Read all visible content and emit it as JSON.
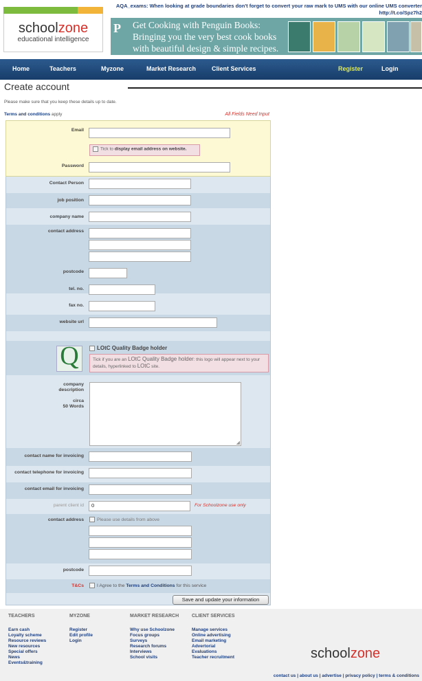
{
  "ticker": "AQA_exams: When looking at grade boundaries don't forget to convert your raw mark to UMS with our online UMS converter http://t.co/Spz7h2",
  "logo": {
    "name": "school",
    "name_accent": "zone",
    "tagline": "educational intelligence"
  },
  "banner": {
    "line1": "Get Cooking with Penguin Books:",
    "line2": "Bringing you the very best cook books",
    "line3": "with beautiful design & simple recipes."
  },
  "nav": {
    "home": "Home",
    "teachers": "Teachers",
    "myzone": "Myzone",
    "market": "Market Research",
    "client": "Client Services",
    "register": "Register",
    "login": "Login"
  },
  "page": {
    "title": "Create account",
    "intro": "Please make sure that you keep these details up to date.",
    "terms_link": "Terms and conditions",
    "terms_suffix": "apply",
    "required_note": "All Fields Need Input"
  },
  "form": {
    "email_label": "Email",
    "display_email": "Tick to",
    "display_email_b": "display email address on website.",
    "password_label": "Password",
    "contact_person_label": "Contact Person",
    "job_position_label": "job position",
    "company_name_label": "company name",
    "contact_address_label": "contact address",
    "postcode_label": "postcode",
    "tel_label": "tel. no.",
    "fax_label": "fax no.",
    "website_label": "website url",
    "lotc_label": "LOtC Quality Badge holder",
    "lotc_hint1": "Tick if you are an",
    "lotc_hint_big": "LOtC Quality Badge holder",
    "lotc_hint2": ": this logo will appear next to your details, hyperlinked to",
    "lotc_hint_big2": "LOtC",
    "lotc_hint3": "site.",
    "desc_label1": "company",
    "desc_label2": "description",
    "desc_label3": "circa",
    "desc_label4": "50 Words",
    "inv_name_label": "contact name for invoicing",
    "inv_tel_label": "contact telephone for invoicing",
    "inv_email_label": "contact email for invoicing",
    "parent_label": "parent client id",
    "parent_value": "0",
    "parent_note": "For Schoolzone use only",
    "inv_address_label": "contact address",
    "use_above": "Please use details from above",
    "inv_postcode_label": "postcode",
    "tcs_label": "T&Cs",
    "agree_prefix": "I Agree to the",
    "agree_link": "Terms and Conditions",
    "agree_suffix": "for this service",
    "save_label": "Save and update your information"
  },
  "footer": {
    "teachers_head": "TEACHERS",
    "teachers_items": [
      "Earn cash",
      "Loyalty scheme",
      "Resource reviews",
      "New resources",
      "Special offers",
      "News",
      "Events&training"
    ],
    "myzone_head": "MYZONE",
    "myzone_items": [
      "Register",
      "Edit profile",
      "Login"
    ],
    "market_head": "MARKET RESEARCH",
    "market_items": [
      "Why use Schoolzone",
      "Focus groups",
      "Surveys",
      "Research forums",
      "Interviews",
      "School visits"
    ],
    "client_head": "CLIENT SERVICES",
    "client_items": [
      "Manage services",
      "Online advertising",
      "Email marketing",
      "Advertorial",
      "Evaluations",
      "Teacher recruitment"
    ],
    "logo_name": "school",
    "logo_accent": "zone",
    "links": "contact us | about us | advertise | privacy policy | terms & conditions"
  },
  "colors": {
    "nav": "#1f4a7e",
    "accent": "#d6302a",
    "register": "#ddea5c",
    "link": "#1f3e7a"
  }
}
